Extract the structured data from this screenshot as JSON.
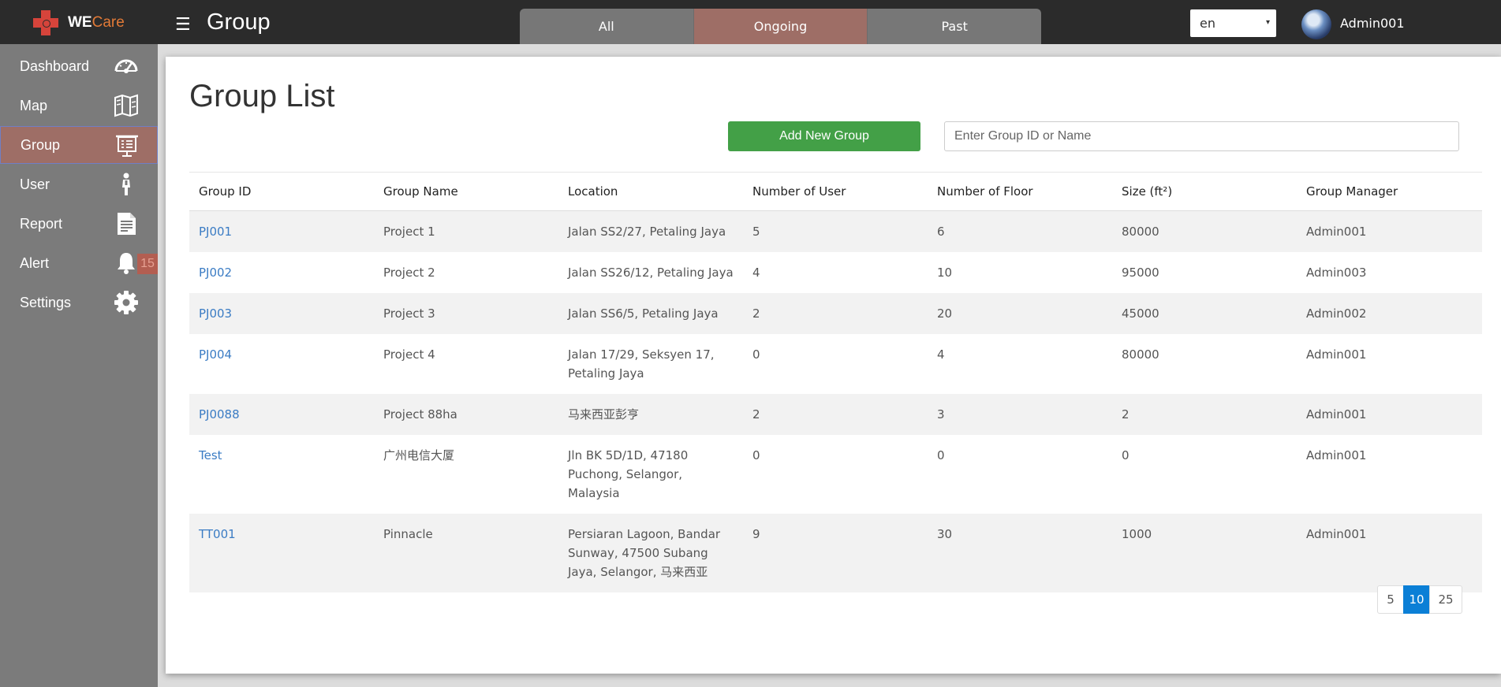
{
  "app": {
    "brand_we": "WE",
    "brand_care": "Care",
    "page_heading": "Group",
    "menu_icon": "☰"
  },
  "tabs": [
    {
      "label": "All"
    },
    {
      "label": "Ongoing",
      "active": true
    },
    {
      "label": "Past"
    }
  ],
  "language": {
    "value": "en",
    "caret": "▾"
  },
  "user": {
    "name": "Admin001"
  },
  "sidebar": {
    "items": [
      {
        "label": "Dashboard",
        "icon": "gauge-icon"
      },
      {
        "label": "Map",
        "icon": "map-icon"
      },
      {
        "label": "Group",
        "icon": "presentation-board-icon",
        "active": true
      },
      {
        "label": "User",
        "icon": "person-icon"
      },
      {
        "label": "Report",
        "icon": "document-icon"
      },
      {
        "label": "Alert",
        "icon": "bell-icon",
        "badge": "15"
      },
      {
        "label": "Settings",
        "icon": "gear-icon"
      }
    ]
  },
  "main": {
    "title": "Group List",
    "add_button": "Add New Group",
    "search_placeholder": "Enter Group ID or Name",
    "table": {
      "headers": [
        "Group ID",
        "Group Name",
        "Location",
        "Number of User",
        "Number of Floor",
        "Size (ft²)",
        "Group Manager"
      ],
      "rows": [
        [
          "PJ001",
          "Project 1",
          "Jalan SS2/27, Petaling Jaya",
          "5",
          "6",
          "80000",
          "Admin001"
        ],
        [
          "PJ002",
          "Project 2",
          "Jalan SS26/12, Petaling Jaya",
          "4",
          "10",
          "95000",
          "Admin003"
        ],
        [
          "PJ003",
          "Project 3",
          "Jalan SS6/5, Petaling Jaya",
          "2",
          "20",
          "45000",
          "Admin002"
        ],
        [
          "PJ004",
          "Project 4",
          "Jalan 17/29, Seksyen 17, Petaling Jaya",
          "0",
          "4",
          "80000",
          "Admin001"
        ],
        [
          "PJ0088",
          "Project 88ha",
          "马来西亚彭亨",
          "2",
          "3",
          "2",
          "Admin001"
        ],
        [
          "Test",
          "广州电信大厦",
          "Jln BK 5D/1D, 47180 Puchong, Selangor, Malaysia",
          "0",
          "0",
          "0",
          "Admin001"
        ],
        [
          "TT001",
          "Pinnacle",
          "Persiaran Lagoon, Bandar Sunway, 47500 Subang Jaya, Selangor, 马来西亚",
          "9",
          "30",
          "1000",
          "Admin001"
        ]
      ]
    },
    "pagination": {
      "options": [
        "5",
        "10",
        "25"
      ],
      "selected": "10"
    }
  },
  "colors": {
    "accent": "#0b7fd6",
    "active_tab": "#9e6e66",
    "add_button": "#43a047",
    "link": "#3b7cc4"
  }
}
